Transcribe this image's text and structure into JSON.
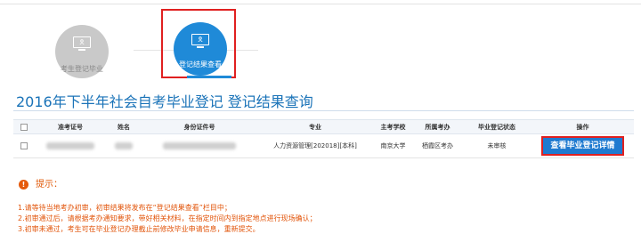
{
  "steps": [
    {
      "label": "考生登记毕业",
      "active": false
    },
    {
      "label": "登记结果查看",
      "active": true
    }
  ],
  "page_title": "2016年下半年社会自考毕业登记 登记结果查询",
  "table": {
    "headers": [
      "",
      "准考证号",
      "姓名",
      "身份证件号",
      "专业",
      "主考学校",
      "所属考办",
      "毕业登记状态",
      "操作"
    ],
    "row": {
      "major": "人力资源管理[202018][本科]",
      "school": "南京大学",
      "office": "栖霞区考办",
      "status": "未审核",
      "action": "查看毕业登记详情"
    }
  },
  "tips": {
    "heading": "提示：",
    "items": [
      "1.请等待当地考办初审，初审结果将发布在“登记结果查看”栏目中；",
      "2.初审通过后，请根据考办通知要求，带好相关材料，在指定时间内到指定地点进行现场确认；",
      "3.初审未通过，考生可在毕业登记办理截止前修改毕业申请信息，重新提交。"
    ]
  },
  "colors": {
    "accent": "#1f8ad8",
    "highlight": "#e02020",
    "warning": "#e2540a"
  }
}
